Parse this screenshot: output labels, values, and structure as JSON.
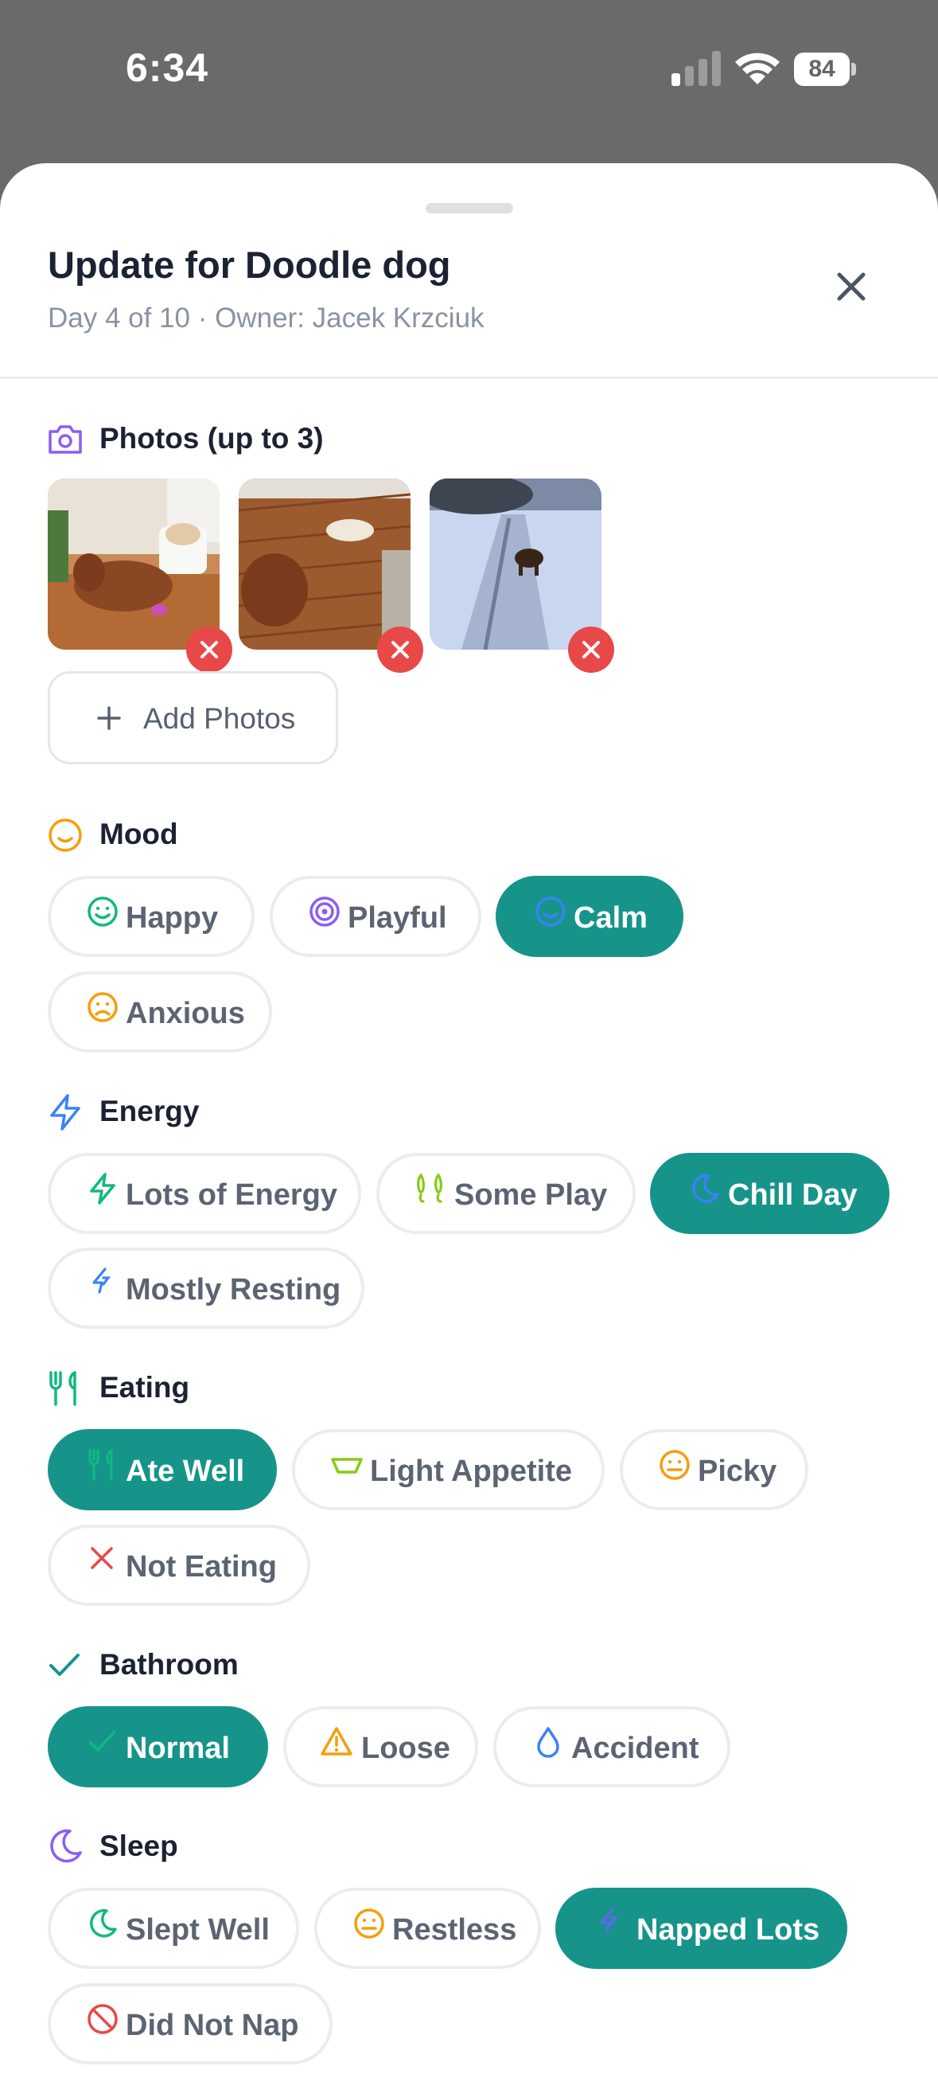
{
  "status_bar": {
    "time": "6:34",
    "battery": "84"
  },
  "sheet": {
    "title": "Update for Doodle dog",
    "subtitle": "Day 4 of 10 · Owner: Jacek Krzciuk"
  },
  "photos": {
    "label": "Photos (up to 3)",
    "add_label": "Add Photos"
  },
  "sections": {
    "mood": {
      "label": "Mood",
      "options": [
        {
          "label": "Happy",
          "icon": "smile-icon",
          "selected": false
        },
        {
          "label": "Playful",
          "icon": "target-icon",
          "selected": false
        },
        {
          "label": "Calm",
          "icon": "smile-icon",
          "selected": true
        },
        {
          "label": "Anxious",
          "icon": "frown-icon",
          "selected": false
        }
      ]
    },
    "energy": {
      "label": "Energy",
      "options": [
        {
          "label": "Lots of Energy",
          "icon": "bolt-icon",
          "selected": false
        },
        {
          "label": "Some Play",
          "icon": "footprints-icon",
          "selected": false
        },
        {
          "label": "Chill Day",
          "icon": "moon-icon",
          "selected": true
        },
        {
          "label": "Mostly Resting",
          "icon": "bolt-off-icon",
          "selected": false
        }
      ]
    },
    "eating": {
      "label": "Eating",
      "options": [
        {
          "label": "Ate Well",
          "icon": "utensils-icon",
          "selected": true
        },
        {
          "label": "Light Appetite",
          "icon": "bowl-icon",
          "selected": false
        },
        {
          "label": "Picky",
          "icon": "meh-icon",
          "selected": false
        },
        {
          "label": "Not Eating",
          "icon": "x-icon",
          "selected": false
        }
      ]
    },
    "bathroom": {
      "label": "Bathroom",
      "options": [
        {
          "label": "Normal",
          "icon": "check-icon",
          "selected": true
        },
        {
          "label": "Loose",
          "icon": "warning-icon",
          "selected": false
        },
        {
          "label": "Accident",
          "icon": "droplet-icon",
          "selected": false
        }
      ]
    },
    "sleep": {
      "label": "Sleep",
      "options": [
        {
          "label": "Slept Well",
          "icon": "moon-icon",
          "selected": false
        },
        {
          "label": "Restless",
          "icon": "meh-icon",
          "selected": false
        },
        {
          "label": "Napped Lots",
          "icon": "bolt-off-icon",
          "selected": true
        },
        {
          "label": "Did Not Nap",
          "icon": "ban-icon",
          "selected": false
        }
      ]
    }
  },
  "colors": {
    "accent": "#16948a",
    "remove": "#e94848",
    "photos_icon": "#8b5cf6",
    "mood_icon": "#f59e0b",
    "energy_icon": "#3b82f6",
    "eating_icon": "#10b981",
    "bathroom_icon": "#16948a",
    "sleep_icon": "#8b5cf6"
  }
}
